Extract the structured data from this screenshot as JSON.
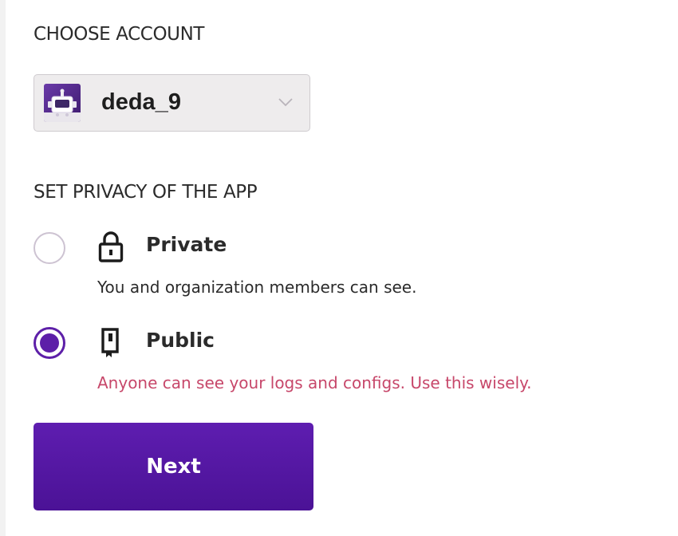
{
  "account_section": {
    "label": "CHOOSE ACCOUNT",
    "selected_account": "deda_9",
    "avatar_icon": "robot-avatar-icon",
    "dropdown_icon": "chevron-down-icon"
  },
  "privacy_section": {
    "label": "SET PRIVACY OF THE APP",
    "options": [
      {
        "title": "Private",
        "description": "You and organization members can see.",
        "icon": "lock-icon",
        "selected": false
      },
      {
        "title": "Public",
        "description": "Anyone can see your logs and configs. Use this wisely.",
        "icon": "book-icon",
        "selected": true
      }
    ]
  },
  "actions": {
    "next_label": "Next"
  },
  "colors": {
    "accent": "#5d1fa8",
    "warning_text": "#c7476a",
    "select_bg": "#eeeced"
  }
}
